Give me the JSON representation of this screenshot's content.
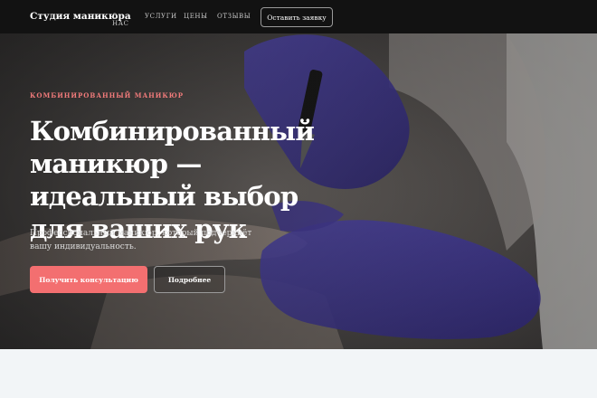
{
  "brand": "Студия маникюра",
  "nav": [
    "О НАС",
    "УСЛУГИ",
    "ЦЕНЫ",
    "ОТЗЫВЫ"
  ],
  "nav_cta": "Оставить заявку",
  "hero": {
    "eyebrow": "КОМБИНИРОВАННЫЙ МАНИКЮР",
    "title": "Комбинированный маникюр — идеальный выбор для ваших рук",
    "subtitle": "Профессиональный маникюр, который подчеркнёт вашу индивидуальность.",
    "primary_button": "Получить консультацию",
    "secondary_button": "Подробнее"
  },
  "colors": {
    "accent": "#f36f70",
    "navbar": "#121212",
    "glove": "#4a3fa8"
  }
}
